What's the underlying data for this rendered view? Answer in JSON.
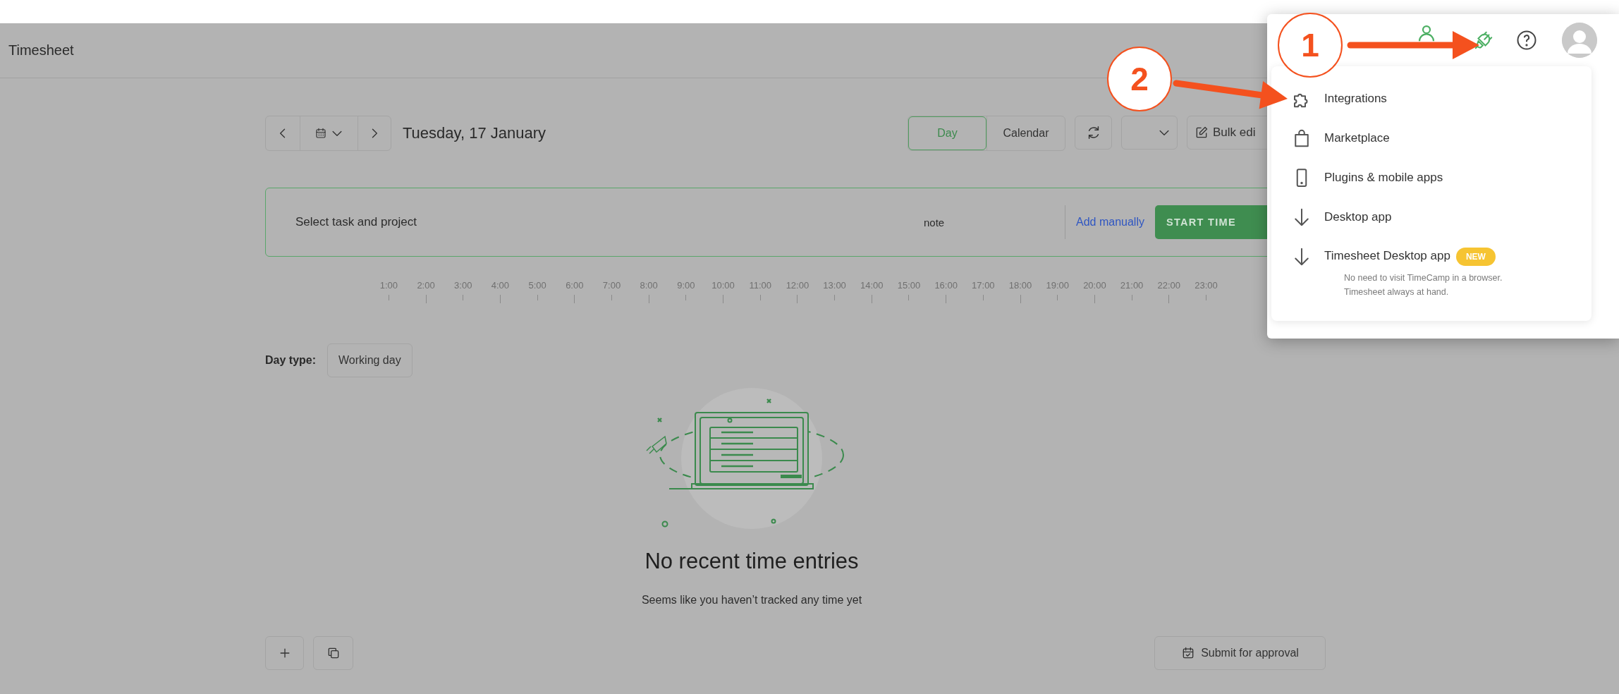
{
  "header": {
    "title": "Timesheet"
  },
  "date_nav": {
    "date": "Tuesday, 17 January"
  },
  "view_tabs": [
    {
      "label": "Day",
      "selected": true
    },
    {
      "label": "Calendar",
      "selected": false
    }
  ],
  "toolbar": {
    "bulk_edit": "Bulk edi"
  },
  "timer": {
    "task": {
      "placeholder": "Select task and project"
    },
    "note": {
      "placeholder": "note"
    },
    "add_manually": "Add manually",
    "start": "START TIME"
  },
  "timeline": {
    "hours": [
      "1:00",
      "2:00",
      "3:00",
      "4:00",
      "5:00",
      "6:00",
      "7:00",
      "8:00",
      "9:00",
      "10:00",
      "11:00",
      "12:00",
      "13:00",
      "14:00",
      "15:00",
      "16:00",
      "17:00",
      "18:00",
      "19:00",
      "20:00",
      "21:00",
      "22:00",
      "23:00"
    ]
  },
  "day_type": {
    "label": "Day type:",
    "value": "Working day"
  },
  "empty_state": {
    "title": "No recent time entries",
    "subtitle": "Seems like you haven’t tracked any time yet"
  },
  "footer": {
    "submit": "Submit for approval"
  },
  "menu": {
    "items": [
      {
        "label": "Integrations"
      },
      {
        "label": "Marketplace"
      },
      {
        "label": "Plugins & mobile apps"
      },
      {
        "label": "Desktop app"
      },
      {
        "label": "Timesheet Desktop app",
        "badge": "NEW",
        "description": "No need to visit TimeCamp in a browser. Timesheet always at hand."
      }
    ]
  },
  "annotations": [
    {
      "label": "1"
    },
    {
      "label": "2"
    }
  ]
}
